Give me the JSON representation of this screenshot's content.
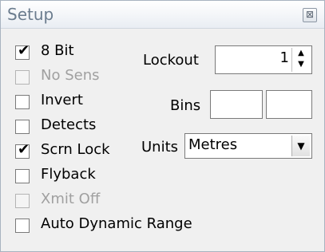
{
  "window": {
    "title": "Setup",
    "close_glyph": "⊠"
  },
  "checkboxes": [
    {
      "label": "8 Bit",
      "checked": true,
      "enabled": true
    },
    {
      "label": "No Sens",
      "checked": false,
      "enabled": false
    },
    {
      "label": "Invert",
      "checked": false,
      "enabled": true
    },
    {
      "label": "Detects",
      "checked": false,
      "enabled": true
    },
    {
      "label": "Scrn Lock",
      "checked": true,
      "enabled": true
    },
    {
      "label": "Flyback",
      "checked": false,
      "enabled": true
    },
    {
      "label": "Xmit Off",
      "checked": false,
      "enabled": false
    },
    {
      "label": "Auto Dynamic Range",
      "checked": false,
      "enabled": true
    }
  ],
  "lockout": {
    "label": "Lockout",
    "value": "1"
  },
  "bins": {
    "label": "Bins",
    "value1": "",
    "value2": ""
  },
  "units": {
    "label": "Units",
    "selected": "Metres"
  },
  "icons": {
    "check": "✔",
    "up": "▲",
    "down": "▼",
    "dropdown": "▼"
  }
}
